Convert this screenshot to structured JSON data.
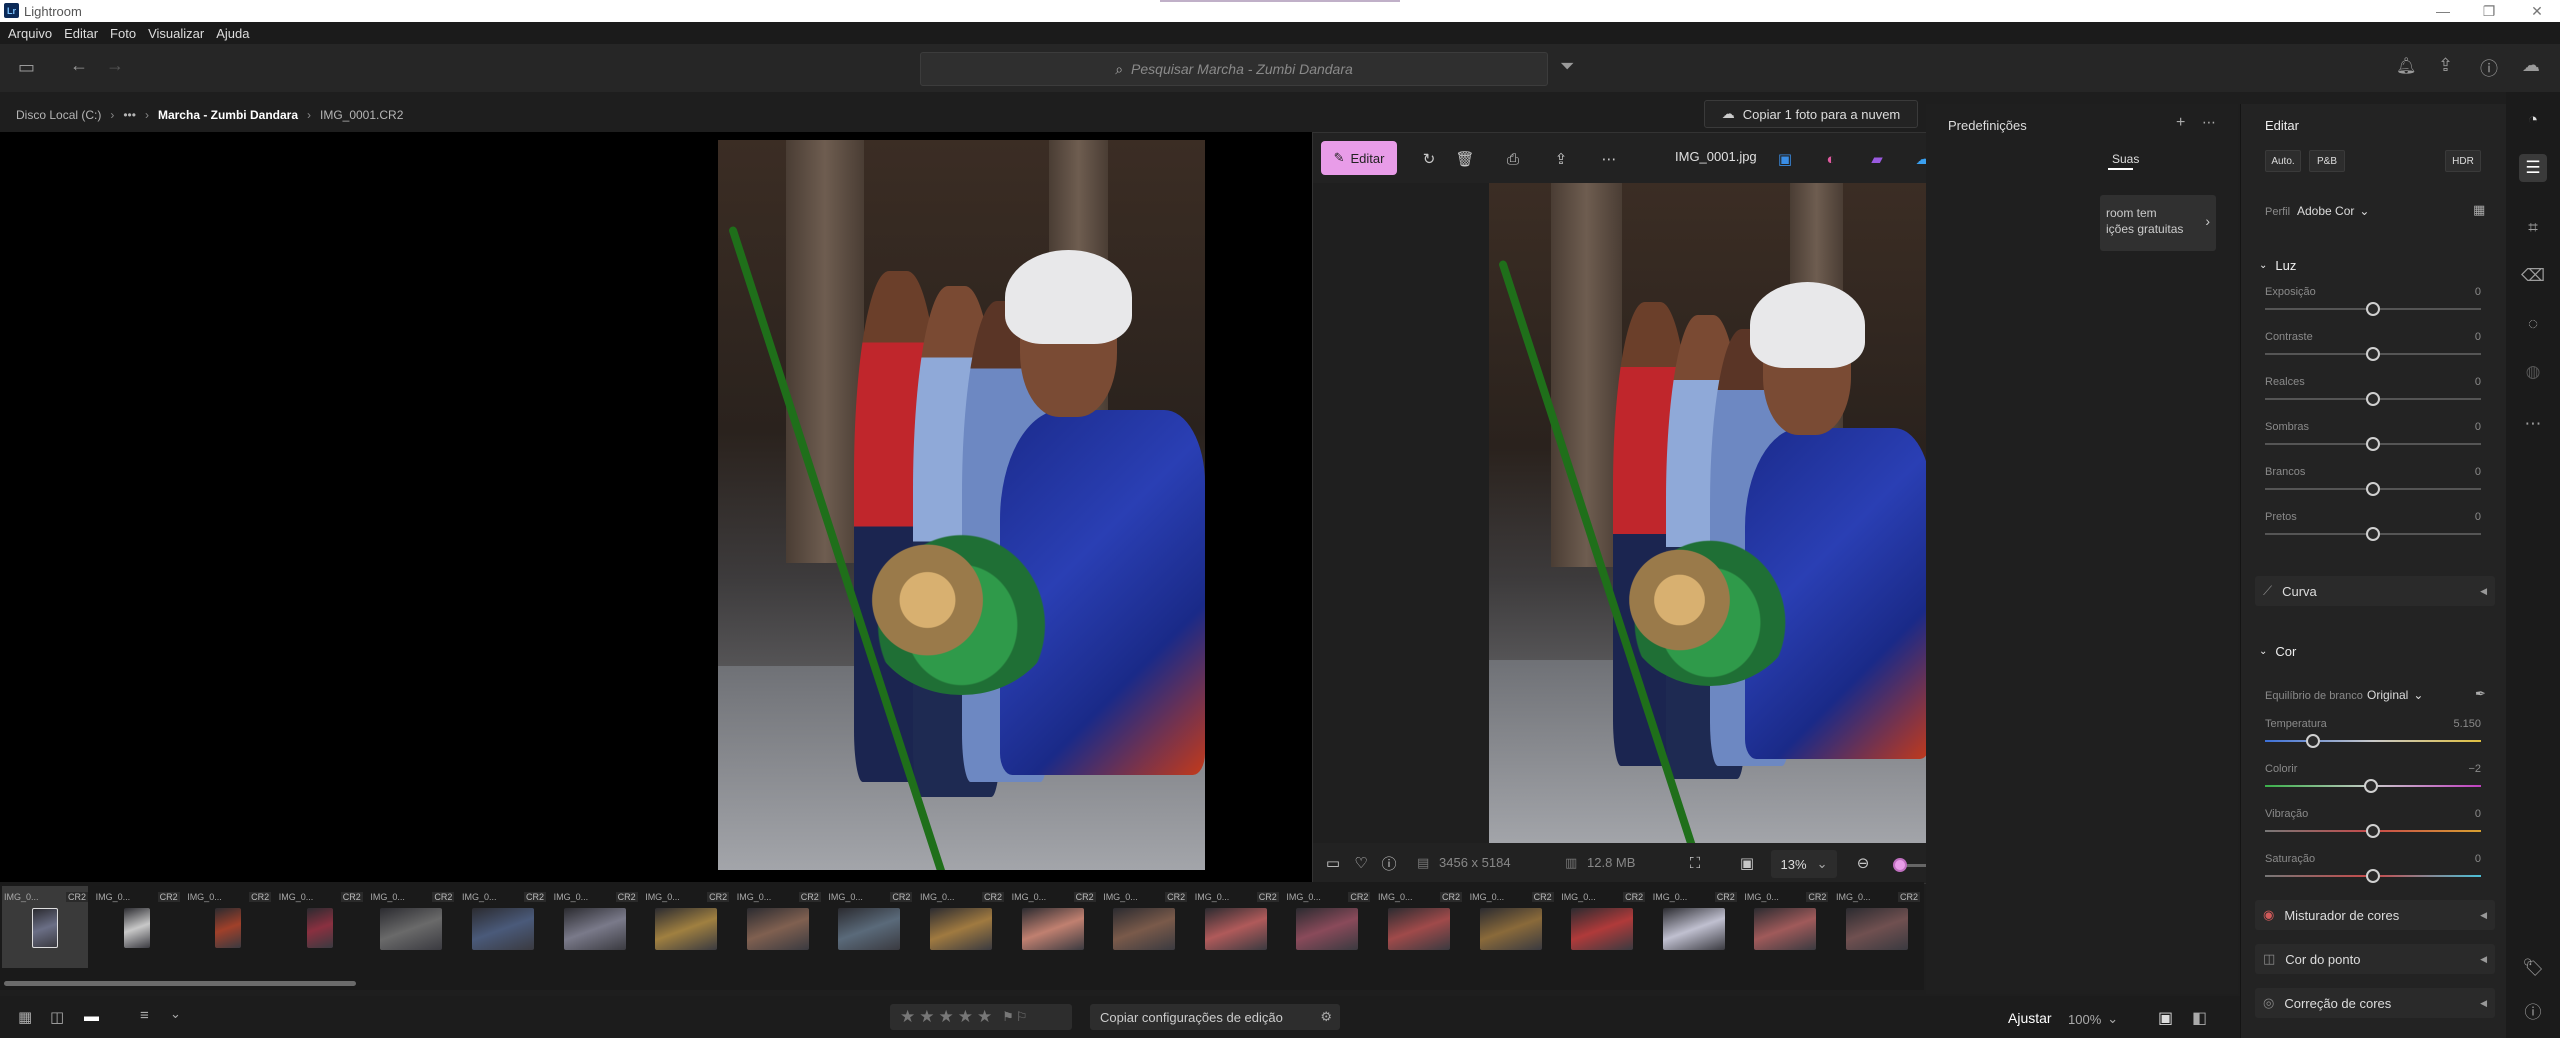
{
  "window": {
    "title": "Lightroom",
    "logo": "Lr"
  },
  "menu": [
    "Arquivo",
    "Editar",
    "Foto",
    "Visualizar",
    "Ajuda"
  ],
  "search": {
    "placeholder": "Pesquisar Marcha - Zumbi Dandara"
  },
  "breadcrumb": {
    "root": "Disco Local (C:)",
    "ellipsis": "•••",
    "folder": "Marcha - Zumbi Dandara",
    "file": "IMG_0001.CR2"
  },
  "cloud_button": "Copiar 1 foto para a nuvem",
  "viewer": {
    "edit_label": "Editar",
    "filename": "IMG_0001.jpg",
    "dimensions": "3456 x 5184",
    "filesize": "12.8 MB",
    "zoom": "13%",
    "zoom_fraction": 0.0
  },
  "presets": {
    "title": "Predefinições",
    "tab": "Suas",
    "promo_line1": "room tem",
    "promo_line2": "ições gratuitas"
  },
  "edit": {
    "title": "Editar",
    "auto": "Auto.",
    "pb": "P&B",
    "hdr": "HDR",
    "profile_label": "Perfil",
    "profile_value": "Adobe Cor",
    "light": {
      "title": "Luz",
      "sliders": [
        {
          "label": "Exposição",
          "value": "0",
          "pos": 0.5
        },
        {
          "label": "Contraste",
          "value": "0",
          "pos": 0.5
        },
        {
          "label": "Realces",
          "value": "0",
          "pos": 0.5
        },
        {
          "label": "Sombras",
          "value": "0",
          "pos": 0.5
        },
        {
          "label": "Brancos",
          "value": "0",
          "pos": 0.5
        },
        {
          "label": "Pretos",
          "value": "0",
          "pos": 0.5
        }
      ]
    },
    "curve": "Curva",
    "color": {
      "title": "Cor",
      "wb_label": "Equilíbrio de branco",
      "wb_value": "Original",
      "sliders": [
        {
          "label": "Temperatura",
          "value": "5.150",
          "pos": 0.22
        },
        {
          "label": "Colorir",
          "value": "−2",
          "pos": 0.49
        },
        {
          "label": "Vibração",
          "value": "0",
          "pos": 0.5
        },
        {
          "label": "Saturação",
          "value": "0",
          "pos": 0.5
        }
      ]
    },
    "mixer": "Misturador de cores",
    "point": "Cor do ponto",
    "correction": "Correção de cores"
  },
  "filmstrip": [
    {
      "name": "IMG_0...",
      "type": "CR2"
    },
    {
      "name": "IMG_0...",
      "type": "CR2"
    },
    {
      "name": "IMG_0...",
      "type": "CR2"
    },
    {
      "name": "IMG_0...",
      "type": "CR2"
    },
    {
      "name": "IMG_0...",
      "type": "CR2"
    },
    {
      "name": "IMG_0...",
      "type": "CR2"
    },
    {
      "name": "IMG_0...",
      "type": "CR2"
    },
    {
      "name": "IMG_0...",
      "type": "CR2"
    },
    {
      "name": "IMG_0...",
      "type": "CR2"
    },
    {
      "name": "IMG_0...",
      "type": "CR2"
    },
    {
      "name": "IMG_0...",
      "type": "CR2"
    },
    {
      "name": "IMG_0...",
      "type": "CR2"
    },
    {
      "name": "IMG_0...",
      "type": "CR2"
    },
    {
      "name": "IMG_0...",
      "type": "CR2"
    },
    {
      "name": "IMG_0...",
      "type": "CR2"
    },
    {
      "name": "IMG_0...",
      "type": "CR2"
    },
    {
      "name": "IMG_0...",
      "type": "CR2"
    },
    {
      "name": "IMG_0...",
      "type": "CR2"
    },
    {
      "name": "IMG_0...",
      "type": "CR2"
    },
    {
      "name": "IMG_0...",
      "type": "CR2"
    },
    {
      "name": "IMG_0...",
      "type": "CR2"
    }
  ],
  "bottombar": {
    "copy_settings": "Copiar configurações de edição",
    "adjust": "Ajustar",
    "zoom": "100%"
  },
  "colors": {
    "accent": "#e89ce8",
    "panel": "#232323",
    "bg": "#1e1e1e"
  }
}
